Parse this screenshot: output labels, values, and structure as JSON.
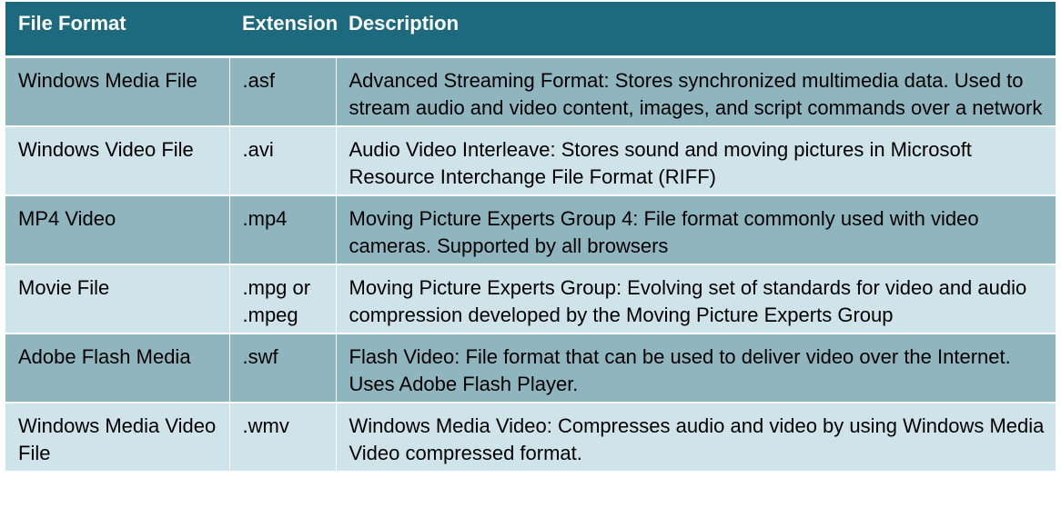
{
  "table": {
    "headers": [
      "File Format",
      "Extension",
      "Description"
    ],
    "rows": [
      {
        "format": "Windows Media File",
        "extension": ".asf",
        "description": "Advanced Streaming Format: Stores synchronized multimedia data. Used to stream audio and video content, images, and script commands over a network"
      },
      {
        "format": "Windows Video File",
        "extension": ".avi",
        "description": "Audio Video Interleave: Stores sound and moving pictures in Microsoft Resource Interchange File Format (RIFF)"
      },
      {
        "format": "MP4 Video",
        "extension": ".mp4",
        "description": "Moving Picture Experts Group 4: File format commonly used with video cameras. Supported by all browsers"
      },
      {
        "format": "Movie File",
        "extension": ".mpg or .mpeg",
        "description": "Moving Picture Experts Group: Evolving set of standards for video and audio compression developed by the Moving Picture Experts Group"
      },
      {
        "format": "Adobe Flash Media",
        "extension": ".swf",
        "description": "Flash Video: File format that can be used to deliver video over the Internet. Uses Adobe Flash Player."
      },
      {
        "format": "Windows Media Video File",
        "extension": ".wmv",
        "description": "Windows Media Video: Compresses audio and video by using Windows Media Video compressed format."
      }
    ]
  },
  "colors": {
    "header_bg": "#1d6a7e",
    "row_dark": "#8fb5bf",
    "row_light": "#cfe3ea"
  }
}
